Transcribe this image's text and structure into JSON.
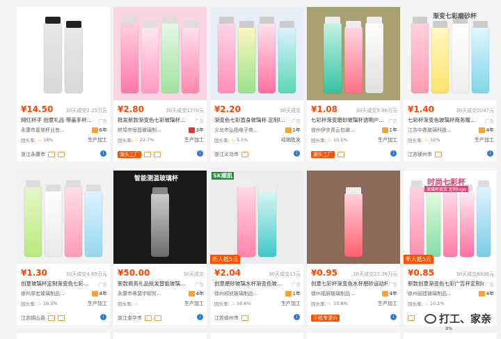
{
  "products": [
    {
      "price": "¥14.50",
      "sold": "30天成交2.25万元",
      "title": "网红杯子 创意礼品 带盖手杯...",
      "ad": "广告",
      "shop": "永康市嘉誉杯业有...",
      "years": "6年",
      "year_color": "orange",
      "rate_label": "回头率:",
      "rate": "18%",
      "mode": "生产加工",
      "location": "浙江永康市",
      "source_tag": "",
      "tags": 2,
      "image": "black",
      "banner": ""
    },
    {
      "price": "¥2.80",
      "sold": "30天成交1270元",
      "title": "批发新款渐变色七彩玻璃杯...",
      "ad": "广告",
      "shop": "蚌埠市恒昌玻璃制...",
      "years": "3年",
      "year_color": "red",
      "rate_label": "回头率:",
      "rate": "22.7%",
      "mode": "生产加工",
      "location": "",
      "source_tag": "源头工厂",
      "tags": 2,
      "image": "pink",
      "banner": ""
    },
    {
      "price": "¥2.20",
      "sold": "30天成交",
      "title": "渐变色七彩直身玻璃杯 定制l...",
      "ad": "广告",
      "shop": "义乌市弘扬电子商...",
      "years": "1年",
      "year_color": "orange",
      "rate_label": "回头率:",
      "rate": "5.5%",
      "mode": "经销批发",
      "location": "浙江义乌市",
      "source_tag": "",
      "tags": 1,
      "image": "rainbow",
      "banner": ""
    },
    {
      "price": "¥1.08",
      "sold": "30天成交5.86万元",
      "title": "七彩杯渐变磨砂玻璃杯透明户...",
      "ad": "广告",
      "shop": "徐州伊步青云包装...",
      "years": "1年",
      "year_color": "orange",
      "rate_label": "回头率:",
      "rate": "10.1%",
      "mode": "生产加工",
      "location": "",
      "source_tag": "源头工厂",
      "tags": 1,
      "image": "grass",
      "banner": ""
    },
    {
      "price": "¥1.40",
      "sold": "30天成交2047元",
      "title": "七彩杯渐变色玻璃杯商务赠...",
      "ad": "广告",
      "shop": "江苏中鼎玻璃科技...",
      "years": "4年",
      "year_color": "orange",
      "rate_label": "回头率:",
      "rate": "15%",
      "mode": "生产加工",
      "location": "江苏徐州市",
      "source_tag": "",
      "tags": 1,
      "image": "gradient",
      "banner": "渐变七彩磨砂杯"
    },
    {
      "price": "¥1.30",
      "sold": "30天成交4.69万元",
      "title": "创意玻璃杯定制渐变色七彩...",
      "ad": "广告",
      "shop": "徐州厚宏玻璃制品...",
      "years": "4年",
      "year_color": "orange",
      "rate_label": "回头率:",
      "rate": "16.5%",
      "mode": "生产加工",
      "location": "江苏铜山县",
      "source_tag": "",
      "tags": 2,
      "image": "green",
      "banner": ""
    },
    {
      "price": "¥50.00",
      "sold": "30天成交",
      "title": "新款商务礼品批发智能玻璃...",
      "ad": "广告",
      "shop": "永康市蒂斐宇顿贸...",
      "years": "4年",
      "year_color": "orange",
      "rate_label": "回头率:",
      "rate": "",
      "mode": "生产加工",
      "location": "浙江金华市",
      "source_tag": "",
      "tags": 2,
      "image": "smart",
      "banner": "智能测温玻璃杯"
    },
    {
      "price": "¥2.04",
      "sold": "30天成交13元",
      "title": "创意磨砂玻璃水杯渐变色玻...",
      "ad": "广告",
      "shop": "徐州顺凯玻璃制品...",
      "years": "1年",
      "year_color": "orange",
      "rate_label": "回头率:",
      "rate": "16.6%",
      "mode": "生产加工",
      "location": "江苏徐州市",
      "source_tag": "",
      "tags": 1,
      "image": "sk",
      "banner": "SK顺凯",
      "new_tag": "新人抵5元"
    },
    {
      "price": "¥0.95",
      "sold": "30天成交27.38万元",
      "title": "创意七彩杯渐变色水杯磨砂运动杯...",
      "ad": "广告",
      "shop": "徐州福辰玻璃制品...",
      "years": "4年",
      "year_color": "orange",
      "rate_label": "回头率:",
      "rate": "10.8%",
      "mode": "生产加工",
      "location": "",
      "source_tag": "手机专享价",
      "tags": 0,
      "image": "single",
      "banner": ""
    },
    {
      "price": "¥0.85",
      "sold": "30天成交8938元",
      "title": "新款创意渐变色七彩广告杯定制logo",
      "ad": "广告",
      "shop": "徐州丽建玻璃制品...",
      "years": "4年",
      "year_color": "orange",
      "rate_label": "回头率:",
      "rate": "10.1%",
      "mode": "",
      "location": "",
      "source_tag": "",
      "tags": 1,
      "image": "seven",
      "banner": "时尚七彩杯",
      "banner_sub": "玻璃杯现货  定制logo",
      "new_tag": "新人抵5元"
    }
  ],
  "watermark": {
    "text": "打工、家亲",
    "sub": "3%"
  },
  "colors": {
    "price": "#ff4400",
    "accent": "#ff5000"
  }
}
